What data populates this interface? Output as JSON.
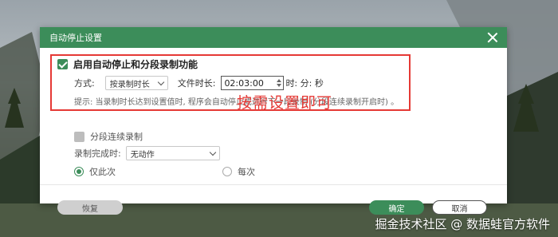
{
  "dialog": {
    "title": "自动停止设置"
  },
  "enable": {
    "label": "启用自动停止和分段录制功能",
    "checked": true
  },
  "mode": {
    "label": "方式:",
    "value": "按录制时长"
  },
  "duration": {
    "label": "文件时长:",
    "value": "02:03:00",
    "units": "时: 分: 秒"
  },
  "tip": "提示: 当录制时长达到设置值时, 程序会自动停止或进行下一段录制 (分段连续录制开启时) 。",
  "segment": {
    "label": "分段连续录制",
    "checked": false
  },
  "on_complete": {
    "label": "录制完成时:",
    "value": "无动作"
  },
  "radios": {
    "once": "仅此次",
    "every": "每次",
    "selected": "once"
  },
  "annotation": "按需设置即可",
  "buttons": {
    "reset": "恢复",
    "ok": "确定",
    "cancel": "取消"
  },
  "watermark": "掘金技术社区 @ 数据蛙官方软件",
  "colors": {
    "accent": "#3c8d5a",
    "annotation_red": "#e53935"
  }
}
